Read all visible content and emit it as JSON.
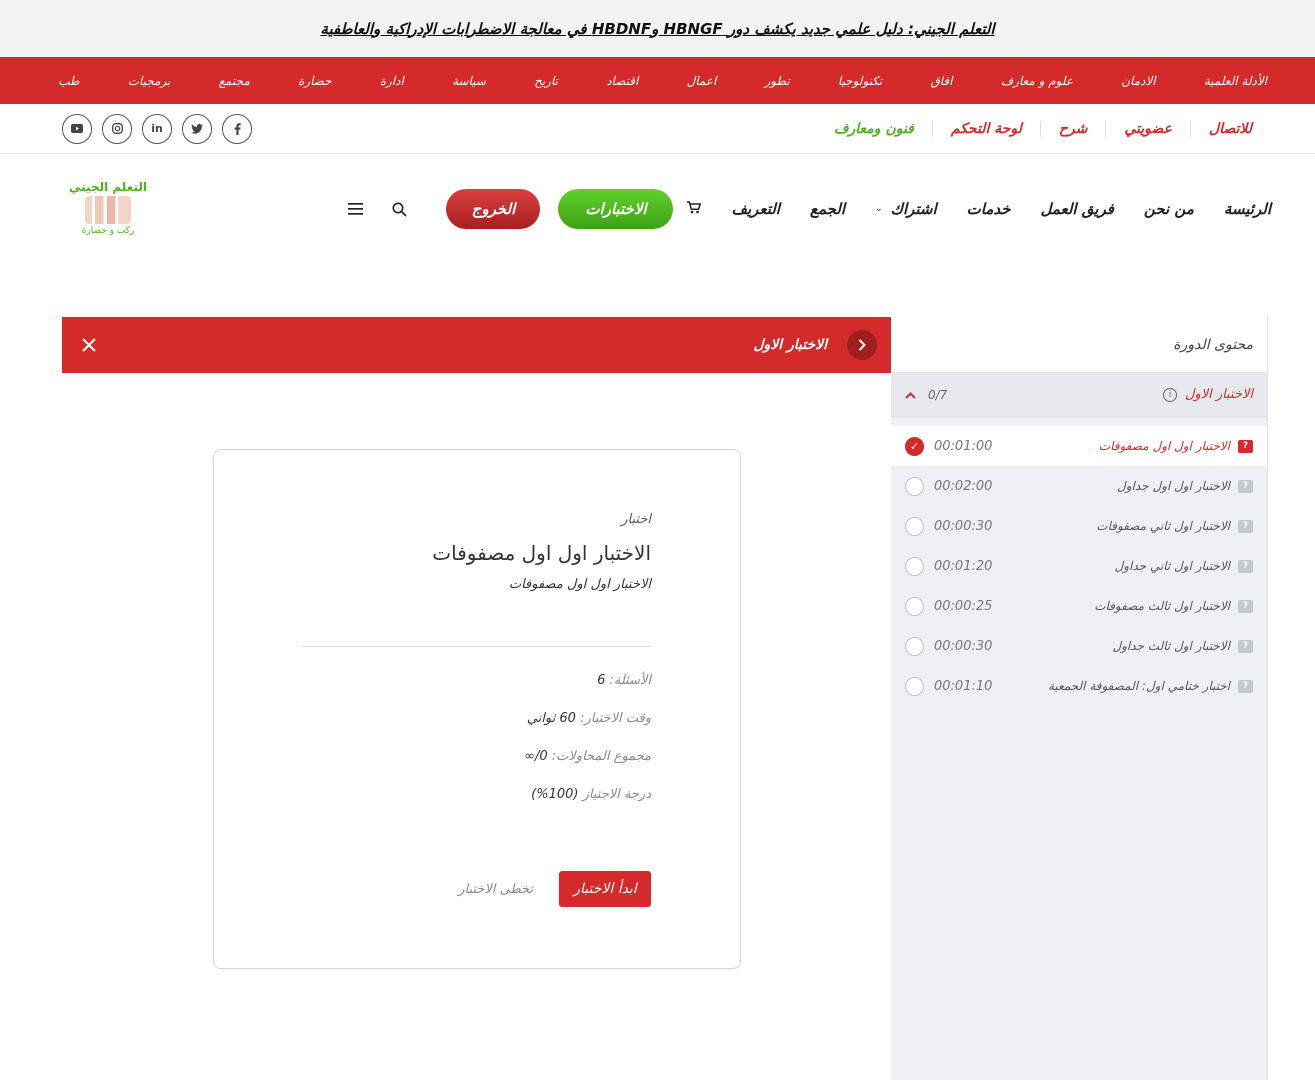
{
  "ticker": {
    "text": "التعلم الجيني: دليل علمي جديد يكشف دور HBNGF وHBDNF في معالجة الاضطرابات الإدراكية والعاطفية"
  },
  "categories": [
    "الأدلة العلمية",
    "الادمان",
    "علوم و معارف",
    "افاق",
    "تكنولوجيا",
    "تطور",
    "اعمال",
    "اقتصاد",
    "تاريخ",
    "سياسة",
    "ادارة",
    "حضارة",
    "مجتمع",
    "برمجيات",
    "طب"
  ],
  "secondary_links": [
    {
      "label": "للاتصال",
      "color": "red"
    },
    {
      "label": "عضويتي",
      "color": "red"
    },
    {
      "label": "شرح",
      "color": "red"
    },
    {
      "label": "لوحة التحكم",
      "color": "red"
    },
    {
      "label": "فنون ومعارف",
      "color": "green"
    }
  ],
  "socials": [
    "facebook-icon",
    "twitter-icon",
    "linkedin-icon",
    "instagram-icon",
    "youtube-icon"
  ],
  "logo": {
    "title": "التعلم الجيني",
    "tagline": "ركب و حضارة"
  },
  "nav": {
    "items": [
      "الرئيسة",
      "من نحن",
      "فريق العمل",
      "خدمات",
      "اشتراك",
      "الجمع",
      "التعريف"
    ],
    "quizzes_button": "الاختبارات",
    "logout_button": "الخروج"
  },
  "quizbar": {
    "title": "الاختبار الاول"
  },
  "sidebar": {
    "title": "محتوى الدورة",
    "section": {
      "name": "الاختبار الاول",
      "progress": "0/7"
    },
    "lessons": [
      {
        "name": "الاختبار اول اول مصفوفات",
        "time": "00:01:00",
        "active": true,
        "done": true
      },
      {
        "name": "الاختبار اول اول جداول",
        "time": "00:02:00",
        "active": false,
        "done": false
      },
      {
        "name": "الاختبار اول ثاني مصفوفات",
        "time": "00:00:30",
        "active": false,
        "done": false
      },
      {
        "name": "الاختبار اول ثاني جداول",
        "time": "00:01:20",
        "active": false,
        "done": false
      },
      {
        "name": "الاختبار اول ثالث مصفوفات",
        "time": "00:00:25",
        "active": false,
        "done": false
      },
      {
        "name": "الاختبار اول ثالث جداول",
        "time": "00:00:30",
        "active": false,
        "done": false
      },
      {
        "name": "اختبار ختامي اول: المصفوفة الجمعية",
        "time": "00:01:10",
        "active": false,
        "done": false
      }
    ]
  },
  "card": {
    "kind": "اختبار",
    "title": "الاختبار اول اول مصفوفات",
    "subtitle": "الاختبار اول اول مصفوفات",
    "questions_label": "الأسئلة:",
    "questions_value": "6",
    "time_label": "وقت الاختبار:",
    "time_value": "60 ثواني",
    "attempts_label": "مجموع المحاولات:",
    "attempts_value": "0/∞",
    "pass_label": "درجة الاجتياز",
    "pass_value": "(100%)",
    "start_button": "ابدأ الاختبار",
    "skip_link": "تخطى الاختبار"
  }
}
